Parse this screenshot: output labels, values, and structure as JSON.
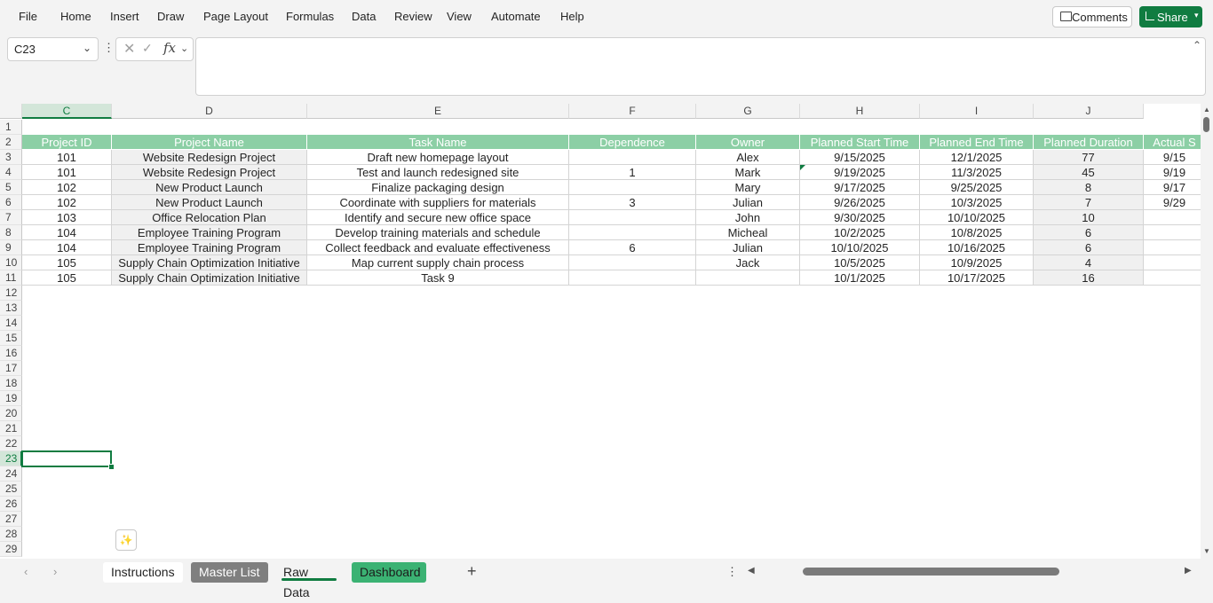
{
  "ribbon": {
    "menu": [
      "File",
      "Home",
      "Insert",
      "Draw",
      "Page Layout",
      "Formulas",
      "Data",
      "Review",
      "View",
      "Automate",
      "Help"
    ],
    "comments_label": "Comments",
    "share_label": "Share"
  },
  "formula_bar": {
    "name_box": "C23",
    "formula": ""
  },
  "grid": {
    "columns": [
      "C",
      "D",
      "E",
      "F",
      "G",
      "H",
      "I",
      "J"
    ],
    "selected_column": "C",
    "row_numbers": [
      1,
      2,
      3,
      4,
      5,
      6,
      7,
      8,
      9,
      10,
      11,
      12,
      13,
      14,
      15,
      16,
      17,
      18,
      19,
      20,
      21,
      22,
      23,
      24,
      25,
      26,
      27,
      28,
      29
    ],
    "selected_row": 23,
    "headers": [
      "Project ID",
      "Project Name",
      "Task Name",
      "Dependence",
      "Owner",
      "Planned Start Time",
      "Planned End Time",
      "Planned Duration",
      "Actual S"
    ],
    "rows": [
      [
        "101",
        "Website Redesign Project",
        "Draft new homepage layout",
        "",
        "Alex",
        "9/15/2025",
        "12/1/2025",
        "77",
        "9/15"
      ],
      [
        "101",
        "Website Redesign Project",
        "Test and launch redesigned site",
        "1",
        "Mark",
        "9/19/2025",
        "11/3/2025",
        "45",
        "9/19"
      ],
      [
        "102",
        "New Product Launch",
        "Finalize packaging design",
        "",
        "Mary",
        "9/17/2025",
        "9/25/2025",
        "8",
        "9/17"
      ],
      [
        "102",
        "New Product Launch",
        "Coordinate with suppliers for materials",
        "3",
        "Julian",
        "9/26/2025",
        "10/3/2025",
        "7",
        "9/29"
      ],
      [
        "103",
        "Office Relocation Plan",
        "Identify and secure new office space",
        "",
        "John",
        "9/30/2025",
        "10/10/2025",
        "10",
        ""
      ],
      [
        "104",
        "Employee Training Program",
        "Develop training materials and schedule",
        "",
        "Micheal",
        "10/2/2025",
        "10/8/2025",
        "6",
        ""
      ],
      [
        "104",
        "Employee Training Program",
        "Collect feedback and evaluate effectiveness",
        "6",
        "Julian",
        "10/10/2025",
        "10/16/2025",
        "6",
        ""
      ],
      [
        "105",
        "Supply Chain Optimization Initiative",
        "Map current supply chain process",
        "",
        "Jack",
        "10/5/2025",
        "10/9/2025",
        "4",
        ""
      ],
      [
        "105",
        "Supply Chain Optimization Initiative",
        "Task 9",
        "",
        "",
        "10/1/2025",
        "10/17/2025",
        "16",
        ""
      ]
    ],
    "colors": {
      "header_fill": "#8ccfa5",
      "accent": "#107c41",
      "alt_fill": "#f0f0f0"
    }
  },
  "sheets": {
    "tabs": [
      "Instructions",
      "Master List",
      "Raw Data",
      "Dashboard"
    ],
    "active": "Raw Data",
    "add_label": "+"
  }
}
